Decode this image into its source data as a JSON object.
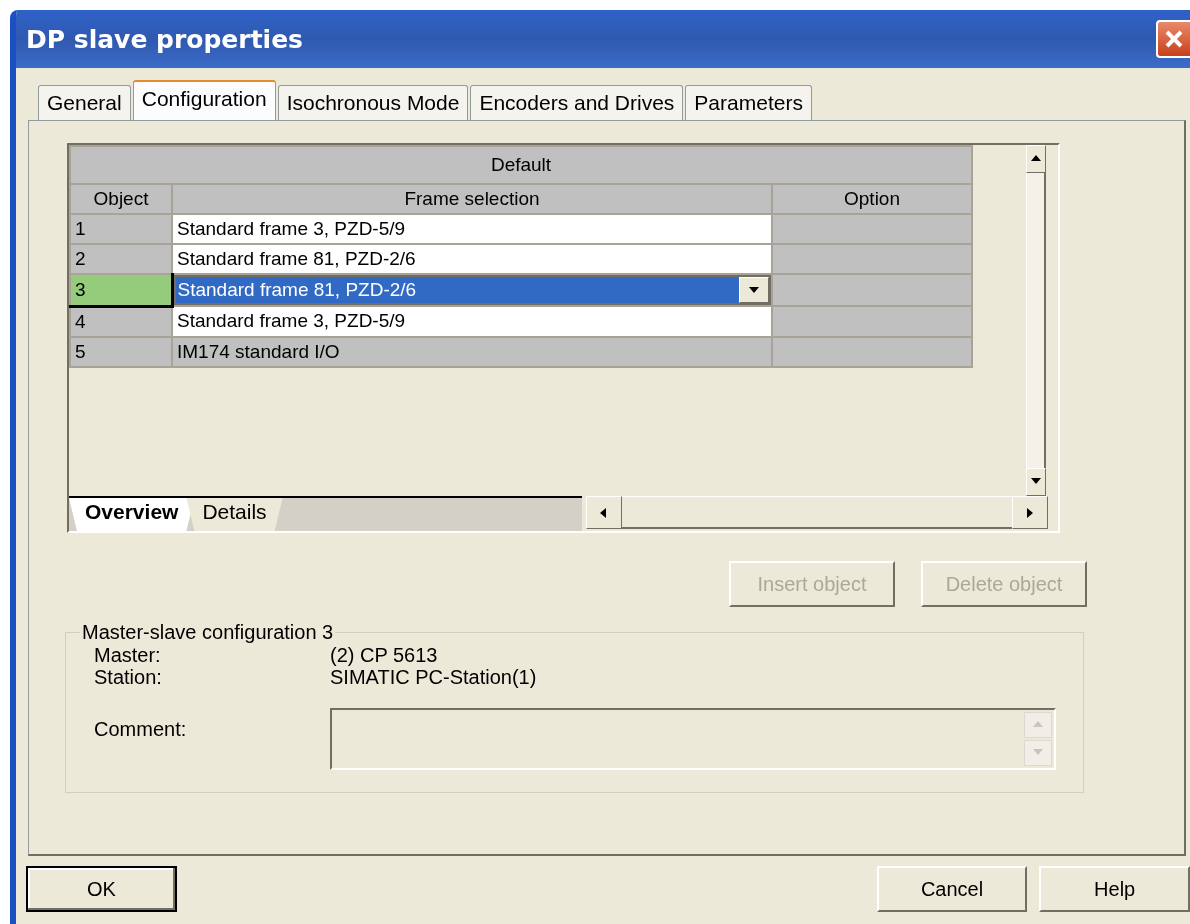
{
  "window": {
    "title": "DP slave properties"
  },
  "tabs": [
    {
      "label": "General",
      "selected": false
    },
    {
      "label": "Configuration",
      "selected": true
    },
    {
      "label": "Isochronous Mode",
      "selected": false
    },
    {
      "label": "Encoders and Drives",
      "selected": false
    },
    {
      "label": "Parameters",
      "selected": false
    }
  ],
  "grid": {
    "group_header": "Default",
    "columns": [
      "Object",
      "Frame selection",
      "Option"
    ],
    "rows": [
      {
        "object": "1",
        "frame": "Standard frame 3, PZD-5/9",
        "editable": true,
        "selected": false
      },
      {
        "object": "2",
        "frame": "Standard frame 81, PZD-2/6",
        "editable": true,
        "selected": false
      },
      {
        "object": "3",
        "frame": "Standard frame 81, PZD-2/6",
        "editable": true,
        "selected": true
      },
      {
        "object": "4",
        "frame": "Standard frame 3, PZD-5/9",
        "editable": true,
        "selected": false
      },
      {
        "object": "5",
        "frame": "IM174 standard I/O",
        "editable": false,
        "selected": false
      }
    ],
    "sheet_tabs": [
      {
        "label": "Overview",
        "selected": true
      },
      {
        "label": "Details",
        "selected": false
      }
    ]
  },
  "object_buttons": [
    {
      "label": "Insert object",
      "disabled": true
    },
    {
      "label": "Delete object",
      "disabled": true
    }
  ],
  "group": {
    "title": "Master-slave configuration 3",
    "fields": [
      {
        "label": "Master:",
        "value": "(2) CP 5613"
      },
      {
        "label": "Station:",
        "value": "SIMATIC PC-Station(1)"
      }
    ],
    "comment": {
      "label": "Comment:",
      "disabled": true
    }
  },
  "footer_buttons": [
    {
      "label": "OK",
      "default": true
    },
    {
      "label": "Cancel",
      "default": false
    },
    {
      "label": "Help",
      "default": false
    }
  ]
}
